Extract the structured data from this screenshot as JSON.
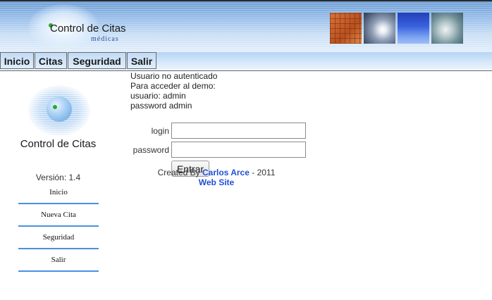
{
  "header": {
    "logo_title": "Control de Citas",
    "logo_subtitle": "médicas"
  },
  "menu": {
    "items": [
      {
        "label": "Inicio"
      },
      {
        "label": "Citas"
      },
      {
        "label": "Seguridad"
      },
      {
        "label": "Salir"
      }
    ]
  },
  "sidebar": {
    "title": "Control de Citas",
    "version": "Versión: 1.4",
    "links": [
      {
        "label": "Inicio"
      },
      {
        "label": "Nueva Cita"
      },
      {
        "label": "Seguridad"
      },
      {
        "label": "Salir"
      }
    ]
  },
  "auth": {
    "status": "Usuario no autenticado",
    "demo_intro": "Para acceder al demo:",
    "demo_user": "usuario: admin",
    "demo_password": "password admin"
  },
  "form": {
    "login_label": "login",
    "login_value": "",
    "password_label": "password",
    "password_value": "",
    "submit_label": "Entrar"
  },
  "footer": {
    "created_by": "Created By",
    "author": "Carlos Arce",
    "year_text": "- 2011",
    "website_label": "Web Site"
  },
  "colors": {
    "link": "#1f4fd8",
    "sidebar_divider": "#4a90e0",
    "logo_green": "#2fa52f"
  }
}
